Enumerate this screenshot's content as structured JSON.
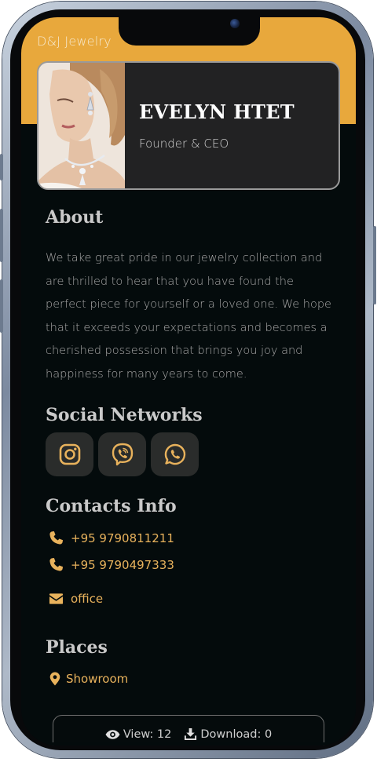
{
  "app": {
    "brand": "D&J Jewelry",
    "accent_color": "#e8a83c",
    "background_color": "#040b0c"
  },
  "profile": {
    "name": "EVELYN HTET",
    "role": "Founder & CEO",
    "photo_icon": "portrait-photo"
  },
  "about": {
    "title": "About",
    "text": "We take great pride in our jewelry collection and are thrilled to hear that you have found the perfect piece for yourself or a loved one. We hope that it exceeds your expectations and becomes a cherished possession that brings you joy and happiness for many years to come."
  },
  "social": {
    "title": "Social Networks",
    "items": [
      {
        "icon": "instagram-icon"
      },
      {
        "icon": "viber-icon"
      },
      {
        "icon": "whatsapp-icon"
      }
    ]
  },
  "contacts": {
    "title": "Contacts Info",
    "phones": [
      "+95 9790811211",
      "+95 9790497333"
    ],
    "email_label": "office"
  },
  "places": {
    "title": "Places",
    "items": [
      "Showroom"
    ]
  },
  "stats": {
    "views_label": "View: 12",
    "downloads_label": "Download: 0"
  }
}
